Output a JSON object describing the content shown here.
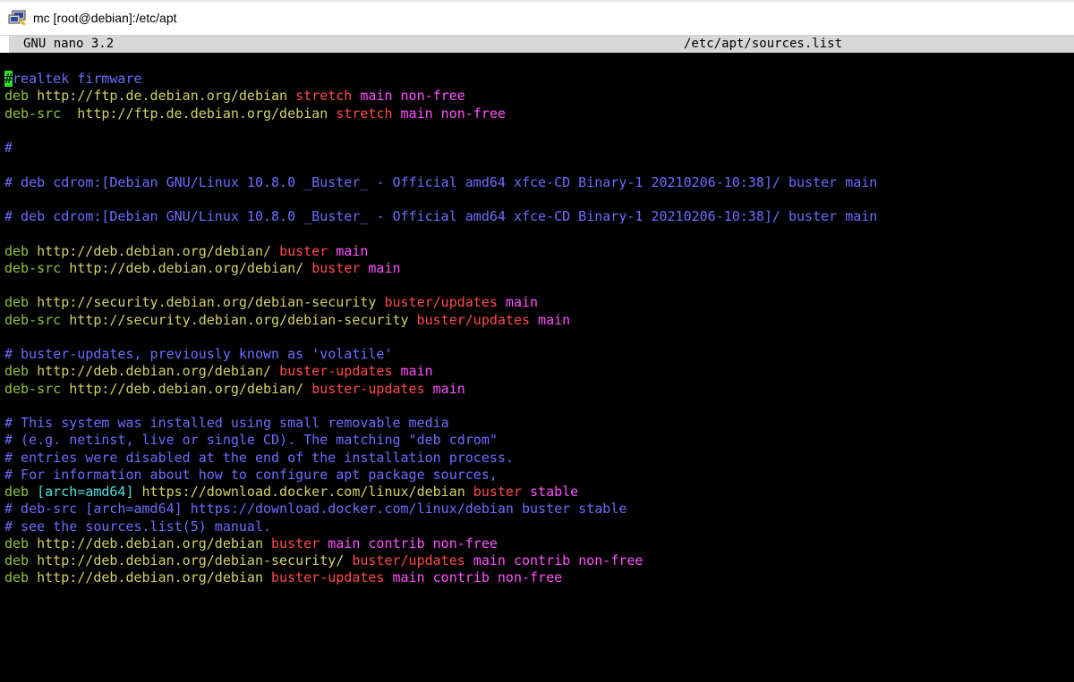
{
  "window": {
    "title": "mc [root@debian]:/etc/apt",
    "icon": "putty-terminal-icon"
  },
  "nano": {
    "version": "GNU nano 3.2",
    "filename": "/etc/apt/sources.list"
  },
  "colors": {
    "comment": "#6c6cff",
    "keyword": "#8ec43e",
    "url": "#cfd26a",
    "distribution": "#ff4a4a",
    "component": "#ff52ff",
    "option": "#4fe0e0",
    "cursor": "#2fe02f"
  },
  "lines": [
    [
      {
        "t": "#",
        "c": "cursor"
      },
      {
        "t": "realtek firmware",
        "c": "comment"
      }
    ],
    [
      {
        "t": "deb ",
        "c": "deb"
      },
      {
        "t": "http://ftp.de.debian.org/debian ",
        "c": "url"
      },
      {
        "t": "stretch ",
        "c": "dist"
      },
      {
        "t": "main non-free",
        "c": "comp"
      }
    ],
    [
      {
        "t": "deb-src  ",
        "c": "deb"
      },
      {
        "t": "http://ftp.de.debian.org/debian ",
        "c": "url"
      },
      {
        "t": "stretch ",
        "c": "dist"
      },
      {
        "t": "main non-free",
        "c": "comp"
      }
    ],
    [],
    [
      {
        "t": "#",
        "c": "comment"
      }
    ],
    [],
    [
      {
        "t": "# deb cdrom:[Debian GNU/Linux 10.8.0 _Buster_ - Official amd64 xfce-CD Binary-1 20210206-10:38]/ buster main",
        "c": "comment"
      }
    ],
    [],
    [
      {
        "t": "# deb cdrom:[Debian GNU/Linux 10.8.0 _Buster_ - Official amd64 xfce-CD Binary-1 20210206-10:38]/ buster main",
        "c": "comment"
      }
    ],
    [],
    [
      {
        "t": "deb ",
        "c": "deb"
      },
      {
        "t": "http://deb.debian.org/debian/ ",
        "c": "url"
      },
      {
        "t": "buster ",
        "c": "dist"
      },
      {
        "t": "main",
        "c": "comp"
      }
    ],
    [
      {
        "t": "deb-src ",
        "c": "deb"
      },
      {
        "t": "http://deb.debian.org/debian/ ",
        "c": "url"
      },
      {
        "t": "buster ",
        "c": "dist"
      },
      {
        "t": "main",
        "c": "comp"
      }
    ],
    [],
    [
      {
        "t": "deb ",
        "c": "deb"
      },
      {
        "t": "http://security.debian.org/debian-security ",
        "c": "url"
      },
      {
        "t": "buster/updates ",
        "c": "dist"
      },
      {
        "t": "main",
        "c": "comp"
      }
    ],
    [
      {
        "t": "deb-src ",
        "c": "deb"
      },
      {
        "t": "http://security.debian.org/debian-security ",
        "c": "url"
      },
      {
        "t": "buster/updates ",
        "c": "dist"
      },
      {
        "t": "main",
        "c": "comp"
      }
    ],
    [],
    [
      {
        "t": "# buster-updates, previously known as 'volatile'",
        "c": "comment"
      }
    ],
    [
      {
        "t": "deb ",
        "c": "deb"
      },
      {
        "t": "http://deb.debian.org/debian/ ",
        "c": "url"
      },
      {
        "t": "buster-updates ",
        "c": "dist"
      },
      {
        "t": "main",
        "c": "comp"
      }
    ],
    [
      {
        "t": "deb-src ",
        "c": "deb"
      },
      {
        "t": "http://deb.debian.org/debian/ ",
        "c": "url"
      },
      {
        "t": "buster-updates ",
        "c": "dist"
      },
      {
        "t": "main",
        "c": "comp"
      }
    ],
    [],
    [
      {
        "t": "# This system was installed using small removable media",
        "c": "comment"
      }
    ],
    [
      {
        "t": "# (e.g. netinst, live or single CD). The matching \"deb cdrom\"",
        "c": "comment"
      }
    ],
    [
      {
        "t": "# entries were disabled at the end of the installation process.",
        "c": "comment"
      }
    ],
    [
      {
        "t": "# For information about how to configure apt package sources,",
        "c": "comment"
      }
    ],
    [
      {
        "t": "deb ",
        "c": "deb"
      },
      {
        "t": "[arch=amd64] ",
        "c": "opt"
      },
      {
        "t": "https://download.docker.com/linux/debian ",
        "c": "url"
      },
      {
        "t": "buster ",
        "c": "dist"
      },
      {
        "t": "stable",
        "c": "comp"
      }
    ],
    [
      {
        "t": "# deb-src [arch=amd64] https://download.docker.com/linux/debian buster stable",
        "c": "comment"
      }
    ],
    [
      {
        "t": "# see the sources.list(5) manual.",
        "c": "comment"
      }
    ],
    [
      {
        "t": "deb ",
        "c": "deb"
      },
      {
        "t": "http://deb.debian.org/debian ",
        "c": "url"
      },
      {
        "t": "buster ",
        "c": "dist"
      },
      {
        "t": "main contrib non-free",
        "c": "comp"
      }
    ],
    [
      {
        "t": "deb ",
        "c": "deb"
      },
      {
        "t": "http://deb.debian.org/debian-security/ ",
        "c": "url"
      },
      {
        "t": "buster/updates ",
        "c": "dist"
      },
      {
        "t": "main contrib non-free",
        "c": "comp"
      }
    ],
    [
      {
        "t": "deb ",
        "c": "deb"
      },
      {
        "t": "http://deb.debian.org/debian ",
        "c": "url"
      },
      {
        "t": "buster-updates ",
        "c": "dist"
      },
      {
        "t": "main contrib non-free",
        "c": "comp"
      }
    ]
  ]
}
